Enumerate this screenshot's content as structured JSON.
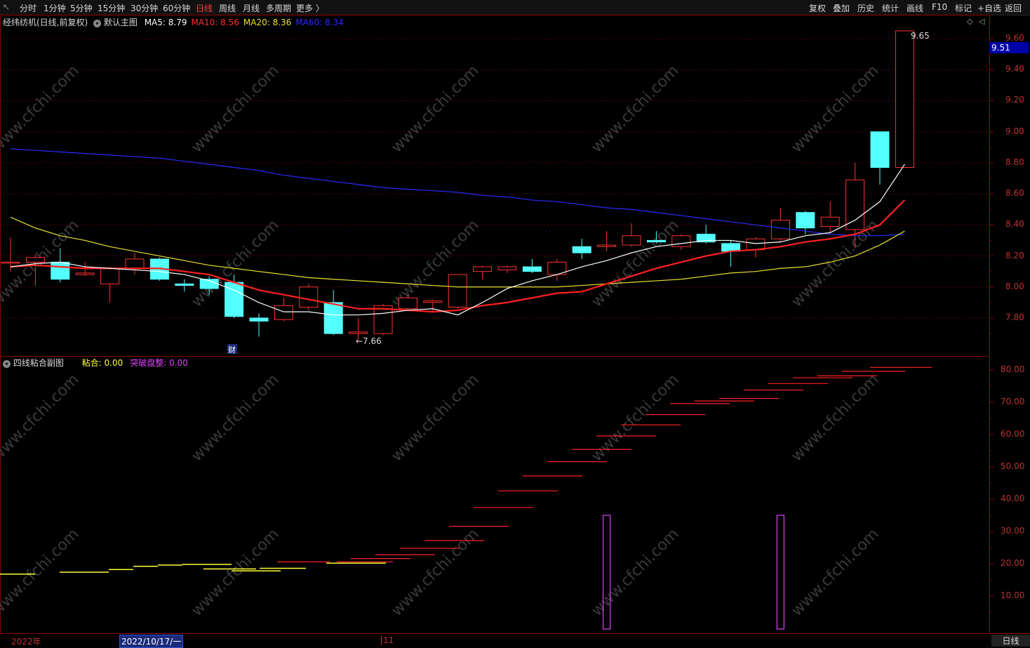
{
  "toolbar": {
    "periods": [
      "分时",
      "1分钟",
      "5分钟",
      "15分钟",
      "30分钟",
      "60分钟",
      "日线",
      "周线",
      "月线",
      "多周期",
      "更多 〉"
    ],
    "active_period": "日线",
    "tools": [
      "复权",
      "叠加",
      "历史",
      "统计",
      "画线",
      "F10",
      "标记",
      "+自选",
      "返回"
    ]
  },
  "main_panel": {
    "stock_title": "经纬纺机(日线,前复权)",
    "template": "默认主图",
    "ma": [
      {
        "label": "MA5: 8.79",
        "color": "#ffffff"
      },
      {
        "label": "MA10: 8.56",
        "color": "#ff3030"
      },
      {
        "label": "MA20: 8.36",
        "color": "#e8e030"
      },
      {
        "label": "MA60: 8.34",
        "color": "#2a2aff"
      }
    ],
    "current_price": "9.51",
    "high_label": "9.65",
    "low_label": "←7.66",
    "event_badge": "财",
    "y_ticks": [
      "9.60",
      "9.40",
      "9.20",
      "9.00",
      "8.80",
      "8.60",
      "8.40",
      "8.20",
      "8.00",
      "7.80"
    ]
  },
  "sub_panel": {
    "title": "四线粘合副图",
    "indicators": [
      {
        "label": "粘合: 0.00",
        "color": "#ffff33"
      },
      {
        "label": "突破盘整: 0.00",
        "color": "#e040ff"
      }
    ],
    "y_ticks": [
      "80.00",
      "70.00",
      "60.00",
      "50.00",
      "40.00",
      "30.00",
      "20.00",
      "10.00"
    ]
  },
  "footer": {
    "year_label": "2022年",
    "cursor_date": "2022/10/17/一",
    "month_mark": "11",
    "period_label": "日线"
  },
  "watermark": "www.cfchi.com",
  "chart_data": {
    "type": "candlestick",
    "ylim": [
      7.6,
      9.7
    ],
    "candles": [
      {
        "o": 8.16,
        "c": 8.16,
        "h": 8.32,
        "l": 8.1
      },
      {
        "o": 8.16,
        "c": 8.19,
        "h": 8.21,
        "l": 8.01
      },
      {
        "o": 8.16,
        "c": 8.05,
        "h": 8.25,
        "l": 8.03
      },
      {
        "o": 8.08,
        "c": 8.09,
        "h": 8.16,
        "l": 8.07
      },
      {
        "o": 8.02,
        "c": 8.12,
        "h": 8.13,
        "l": 7.9
      },
      {
        "o": 8.12,
        "c": 8.18,
        "h": 8.22,
        "l": 8.08
      },
      {
        "o": 8.18,
        "c": 8.05,
        "h": 8.19,
        "l": 8.04
      },
      {
        "o": 8.02,
        "c": 8.01,
        "h": 8.05,
        "l": 7.97
      },
      {
        "o": 8.05,
        "c": 7.99,
        "h": 8.07,
        "l": 7.95
      },
      {
        "o": 8.03,
        "c": 7.81,
        "h": 8.08,
        "l": 7.8
      },
      {
        "o": 7.8,
        "c": 7.78,
        "h": 7.83,
        "l": 7.68
      },
      {
        "o": 7.79,
        "c": 7.88,
        "h": 7.93,
        "l": 7.78
      },
      {
        "o": 7.87,
        "c": 8.0,
        "h": 8.02,
        "l": 7.85
      },
      {
        "o": 7.9,
        "c": 7.7,
        "h": 7.98,
        "l": 7.69
      },
      {
        "o": 7.7,
        "c": 7.71,
        "h": 7.8,
        "l": 7.66
      },
      {
        "o": 7.7,
        "c": 7.88,
        "h": 7.89,
        "l": 7.69
      },
      {
        "o": 7.86,
        "c": 7.93,
        "h": 7.95,
        "l": 7.85
      },
      {
        "o": 7.9,
        "c": 7.91,
        "h": 7.92,
        "l": 7.84
      },
      {
        "o": 7.87,
        "c": 8.08,
        "h": 8.08,
        "l": 7.86
      },
      {
        "o": 8.1,
        "c": 8.13,
        "h": 8.14,
        "l": 8.05
      },
      {
        "o": 8.11,
        "c": 8.13,
        "h": 8.14,
        "l": 8.09
      },
      {
        "o": 8.13,
        "c": 8.1,
        "h": 8.18,
        "l": 8.09
      },
      {
        "o": 8.08,
        "c": 8.16,
        "h": 8.18,
        "l": 8.04
      },
      {
        "o": 8.26,
        "c": 8.22,
        "h": 8.31,
        "l": 8.18
      },
      {
        "o": 8.26,
        "c": 8.27,
        "h": 8.36,
        "l": 8.23
      },
      {
        "o": 8.27,
        "c": 8.33,
        "h": 8.41,
        "l": 8.26
      },
      {
        "o": 8.3,
        "c": 8.29,
        "h": 8.36,
        "l": 8.28
      },
      {
        "o": 8.26,
        "c": 8.33,
        "h": 8.34,
        "l": 8.24
      },
      {
        "o": 8.34,
        "c": 8.29,
        "h": 8.4,
        "l": 8.28
      },
      {
        "o": 8.28,
        "c": 8.23,
        "h": 8.3,
        "l": 8.13
      },
      {
        "o": 8.24,
        "c": 8.31,
        "h": 8.32,
        "l": 8.19
      },
      {
        "o": 8.31,
        "c": 8.43,
        "h": 8.51,
        "l": 8.29
      },
      {
        "o": 8.48,
        "c": 8.38,
        "h": 8.49,
        "l": 8.34
      },
      {
        "o": 8.39,
        "c": 8.45,
        "h": 8.55,
        "l": 8.35
      },
      {
        "o": 8.37,
        "c": 8.69,
        "h": 8.8,
        "l": 8.25
      },
      {
        "o": 9.0,
        "c": 8.77,
        "h": 9.0,
        "l": 8.66
      },
      {
        "o": 8.77,
        "c": 9.65,
        "h": 9.65,
        "l": 8.77
      }
    ],
    "ma5": [
      8.13,
      8.15,
      8.16,
      8.13,
      8.12,
      8.11,
      8.1,
      8.08,
      8.04,
      7.98,
      7.9,
      7.84,
      7.84,
      7.82,
      7.82,
      7.83,
      7.85,
      7.86,
      7.82,
      7.9,
      7.99,
      8.04,
      8.08,
      8.13,
      8.17,
      8.22,
      8.26,
      8.28,
      8.3,
      8.3,
      8.28,
      8.29,
      8.33,
      8.35,
      8.43,
      8.55,
      8.79
    ],
    "ma10": [
      8.13,
      8.14,
      8.13,
      8.12,
      8.12,
      8.12,
      8.12,
      8.1,
      8.08,
      8.03,
      7.98,
      7.95,
      7.92,
      7.89,
      7.86,
      7.86,
      7.85,
      7.84,
      7.85,
      7.88,
      7.9,
      7.93,
      7.96,
      7.97,
      8.02,
      8.07,
      8.12,
      8.16,
      8.2,
      8.23,
      8.24,
      8.26,
      8.29,
      8.31,
      8.34,
      8.4,
      8.56
    ],
    "ma20": [
      8.45,
      8.38,
      8.33,
      8.3,
      8.26,
      8.23,
      8.2,
      8.17,
      8.14,
      8.12,
      8.1,
      8.08,
      8.06,
      8.05,
      8.04,
      8.03,
      8.02,
      8.01,
      8.0,
      8.0,
      8.0,
      8.0,
      8.0,
      8.01,
      8.02,
      8.03,
      8.04,
      8.05,
      8.07,
      8.09,
      8.1,
      8.12,
      8.13,
      8.16,
      8.2,
      8.27,
      8.36
    ],
    "ma60": [
      8.89,
      8.88,
      8.87,
      8.86,
      8.85,
      8.84,
      8.83,
      8.81,
      8.79,
      8.77,
      8.75,
      8.72,
      8.7,
      8.68,
      8.66,
      8.64,
      8.63,
      8.62,
      8.61,
      8.59,
      8.58,
      8.56,
      8.55,
      8.53,
      8.51,
      8.5,
      8.48,
      8.46,
      8.44,
      8.42,
      8.4,
      8.38,
      8.36,
      8.34,
      8.33,
      8.33,
      8.34
    ],
    "sub_ylim": [
      0,
      85
    ],
    "sub_yellow_bars": [
      {
        "x1": 0,
        "x2": 50,
        "v": 16.8
      },
      {
        "x1": 85,
        "x2": 155,
        "v": 17.4
      },
      {
        "x1": 155,
        "x2": 190,
        "v": 18.2
      },
      {
        "x1": 190,
        "x2": 225,
        "v": 19.2
      },
      {
        "x1": 225,
        "x2": 260,
        "v": 19.6
      },
      {
        "x1": 260,
        "x2": 330,
        "v": 19.8
      },
      {
        "x1": 290,
        "x2": 365,
        "v": 18.4
      },
      {
        "x1": 330,
        "x2": 400,
        "v": 17.8
      },
      {
        "x1": 370,
        "x2": 436,
        "v": 18.6
      },
      {
        "x1": 465,
        "x2": 550,
        "v": 20.2
      }
    ],
    "sub_red_steps": [
      {
        "x1": 395,
        "x2": 470,
        "v": 20.6
      },
      {
        "x1": 480,
        "x2": 560,
        "v": 20.6
      },
      {
        "x1": 500,
        "x2": 585,
        "v": 21.6
      },
      {
        "x1": 535,
        "x2": 620,
        "v": 22.8
      },
      {
        "x1": 570,
        "x2": 655,
        "v": 24.8
      },
      {
        "x1": 605,
        "x2": 690,
        "v": 27.2
      },
      {
        "x1": 640,
        "x2": 725,
        "v": 31.6
      },
      {
        "x1": 675,
        "x2": 760,
        "v": 37.4
      },
      {
        "x1": 710,
        "x2": 795,
        "v": 42.6
      },
      {
        "x1": 745,
        "x2": 830,
        "v": 47.2
      },
      {
        "x1": 780,
        "x2": 865,
        "v": 51.6
      },
      {
        "x1": 815,
        "x2": 900,
        "v": 55.4
      },
      {
        "x1": 850,
        "x2": 935,
        "v": 59.6
      },
      {
        "x1": 885,
        "x2": 970,
        "v": 63.0
      },
      {
        "x1": 920,
        "x2": 1005,
        "v": 66.2
      },
      {
        "x1": 955,
        "x2": 1040,
        "v": 69.6
      },
      {
        "x1": 990,
        "x2": 1075,
        "v": 70.4
      },
      {
        "x1": 1025,
        "x2": 1110,
        "v": 71.2
      },
      {
        "x1": 1060,
        "x2": 1145,
        "v": 73.8
      },
      {
        "x1": 1095,
        "x2": 1180,
        "v": 75.8
      },
      {
        "x1": 1130,
        "x2": 1215,
        "v": 77.6
      },
      {
        "x1": 1165,
        "x2": 1250,
        "v": 78.2
      },
      {
        "x1": 1200,
        "x2": 1290,
        "v": 79.6
      },
      {
        "x1": 1240,
        "x2": 1328,
        "v": 80.8
      }
    ],
    "sub_purple_bars": [
      {
        "index": 24,
        "v": 35
      },
      {
        "index": 31,
        "v": 35
      }
    ]
  }
}
